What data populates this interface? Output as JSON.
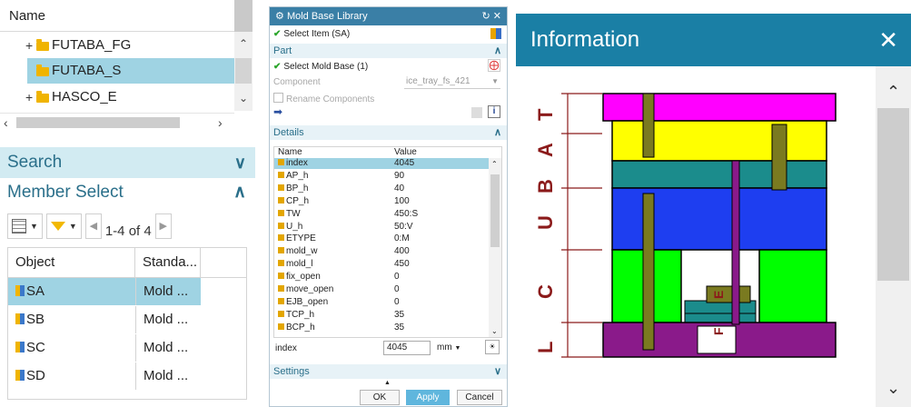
{
  "tree": {
    "header": "Name",
    "items": [
      {
        "label": "FUTABA_FG",
        "expander": "+"
      },
      {
        "label": "FUTABA_S",
        "expander": ""
      },
      {
        "label": "HASCO_E",
        "expander": "+"
      }
    ]
  },
  "search": {
    "label": "Search"
  },
  "member_select": {
    "title": "Member Select",
    "pager": "1-4 of 4",
    "columns": [
      "Object",
      "Standa..."
    ],
    "rows": [
      {
        "object": "SA",
        "standard": "Mold ..."
      },
      {
        "object": "SB",
        "standard": "Mold ..."
      },
      {
        "object": "SC",
        "standard": "Mold ..."
      },
      {
        "object": "SD",
        "standard": "Mold ..."
      }
    ]
  },
  "dialog": {
    "title": "Mold Base Library",
    "select_item": "Select Item (SA)",
    "part_section": "Part",
    "select_mold_base": "Select Mold Base (1)",
    "component_label": "Component",
    "component_value": "ice_tray_fs_421",
    "rename_components": "Rename Components",
    "details_section": "Details",
    "details_columns": [
      "Name",
      "Value"
    ],
    "details_rows": [
      {
        "name": "index",
        "value": "4045"
      },
      {
        "name": "AP_h",
        "value": "90"
      },
      {
        "name": "BP_h",
        "value": "40"
      },
      {
        "name": "CP_h",
        "value": "100"
      },
      {
        "name": "TW",
        "value": "450:S"
      },
      {
        "name": "U_h",
        "value": "50:V"
      },
      {
        "name": "ETYPE",
        "value": "0:M"
      },
      {
        "name": "mold_w",
        "value": "400"
      },
      {
        "name": "mold_l",
        "value": "450"
      },
      {
        "name": "fix_open",
        "value": "0"
      },
      {
        "name": "move_open",
        "value": "0"
      },
      {
        "name": "EJB_open",
        "value": "0"
      },
      {
        "name": "TCP_h",
        "value": "35"
      },
      {
        "name": "BCP_h",
        "value": "35"
      }
    ],
    "index_label": "index",
    "index_value": "4045",
    "unit": "mm",
    "settings_section": "Settings",
    "ok": "OK",
    "apply": "Apply",
    "cancel": "Cancel"
  },
  "info": {
    "title": "Information",
    "dim_labels": [
      "T",
      "A",
      "B",
      "U",
      "C",
      "L",
      "E",
      "F"
    ]
  }
}
